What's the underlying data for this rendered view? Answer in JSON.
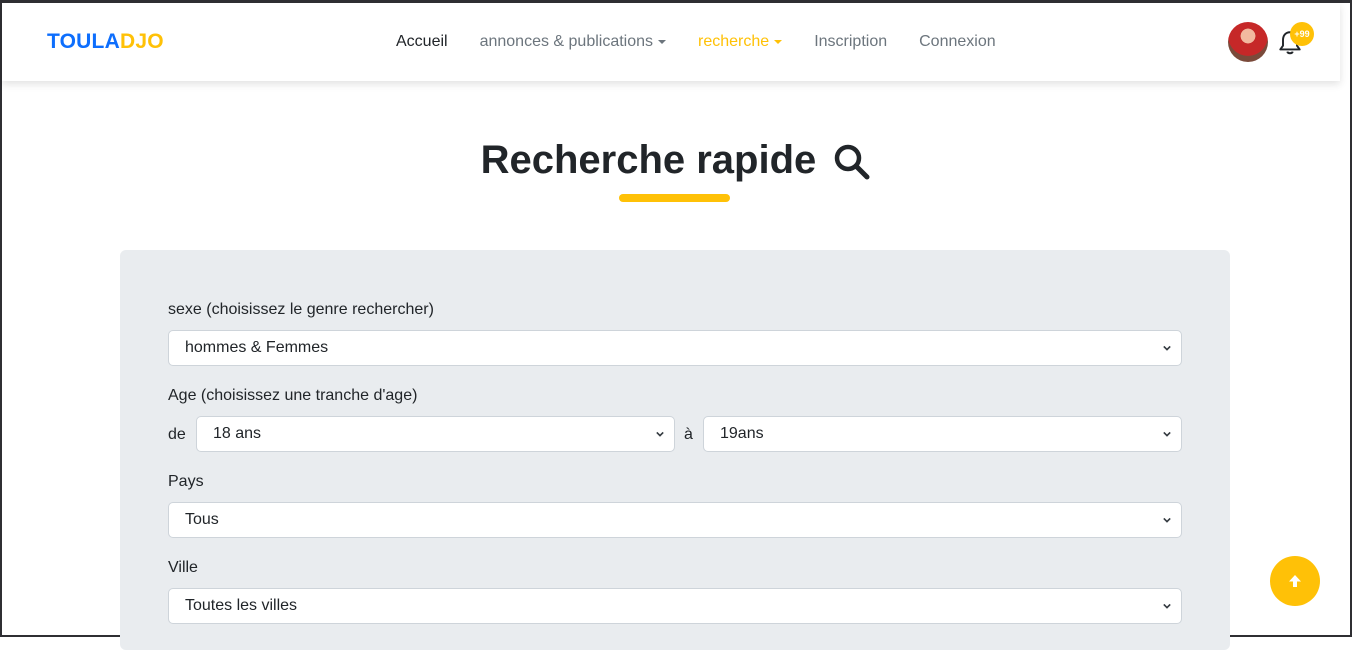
{
  "brand": {
    "part1": "TOULA",
    "part2": "DJO"
  },
  "nav": {
    "home": "Accueil",
    "announcements": "annonces & publications",
    "search": "recherche",
    "signup": "Inscription",
    "login": "Connexion"
  },
  "notifications": {
    "badge": "+99"
  },
  "page": {
    "title": "Recherche rapide"
  },
  "form": {
    "sex": {
      "label": "sexe (choisissez le genre rechercher)",
      "value": "hommes & Femmes"
    },
    "age": {
      "label": "Age (choisissez une tranche d'age)",
      "from_label": "de",
      "from_value": "18 ans",
      "to_label": "à",
      "to_value": "19ans"
    },
    "country": {
      "label": "Pays",
      "value": "Tous"
    },
    "city": {
      "label": "Ville",
      "value": "Toutes les villes"
    }
  },
  "colors": {
    "primary": "#0d6efd",
    "accent": "#ffc107",
    "panel": "#e9ecef"
  },
  "icons": {
    "search": "search-icon",
    "bell": "bell-icon",
    "scroll_top": "arrow-up-icon",
    "select": "chevron-down-icon"
  }
}
